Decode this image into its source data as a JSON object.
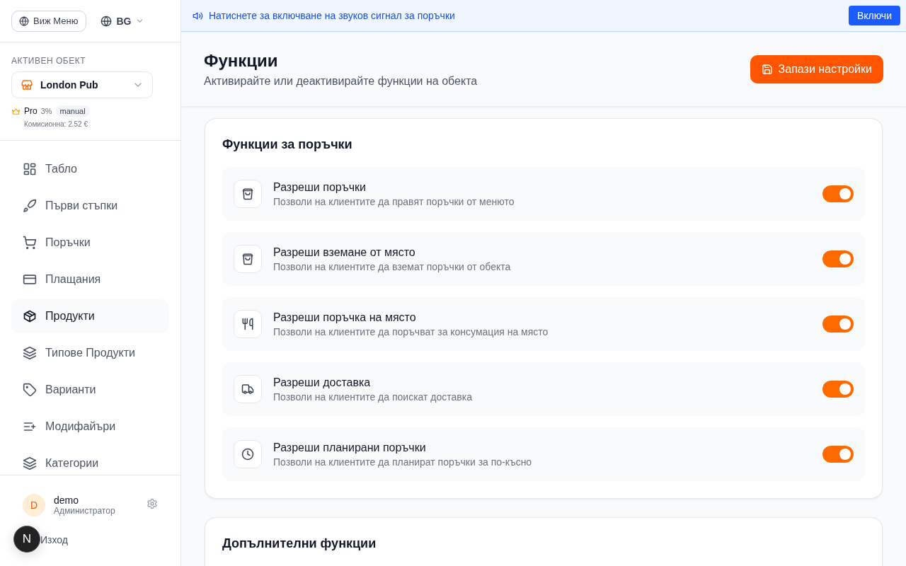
{
  "sidebar": {
    "menu_button": "Виж Меню",
    "language": "BG",
    "active_venue_label": "АКТИВЕН ОБЕКТ",
    "venue": "London Pub",
    "plan": "Pro",
    "plan_rate": "3%",
    "plan_mode": "manual",
    "commission": "Комисионна: 2.52 €",
    "items": [
      {
        "label": "Табло",
        "selected": false
      },
      {
        "label": "Първи стъпки",
        "selected": false
      },
      {
        "label": "Поръчки",
        "selected": false
      },
      {
        "label": "Плащания",
        "selected": false
      },
      {
        "label": "Продукти",
        "selected": true
      },
      {
        "label": "Типове Продукти",
        "selected": false
      },
      {
        "label": "Варианти",
        "selected": false
      },
      {
        "label": "Модифайъри",
        "selected": false
      },
      {
        "label": "Категории",
        "selected": false
      }
    ],
    "user": {
      "initial": "D",
      "name": "demo",
      "role": "Администратор"
    },
    "logout": "Изход",
    "dev_badge": "N"
  },
  "banner": {
    "text": "Натиснете за включване на звуков сигнал за поръчки",
    "button": "Включи"
  },
  "header": {
    "title": "Функции",
    "subtitle": "Активирайте или деактивирайте функции на обекта",
    "save_button": "Запази настройки"
  },
  "sections": [
    {
      "title": "Функции за поръчки",
      "features": [
        {
          "title": "Разреши поръчки",
          "description": "Позволи на клиентите да правят поръчки от менюто",
          "on": true
        },
        {
          "title": "Разреши вземане от място",
          "description": "Позволи на клиентите да вземат поръчки от обекта",
          "on": true
        },
        {
          "title": "Разреши поръчка на място",
          "description": "Позволи на клиентите да поръчват за консумация на място",
          "on": true
        },
        {
          "title": "Разреши доставка",
          "description": "Позволи на клиентите да поискат доставка",
          "on": true
        },
        {
          "title": "Разреши планирани поръчки",
          "description": "Позволи на клиентите да планират поръчки за по-късно",
          "on": true
        }
      ]
    },
    {
      "title": "Допълнителни функции"
    }
  ]
}
